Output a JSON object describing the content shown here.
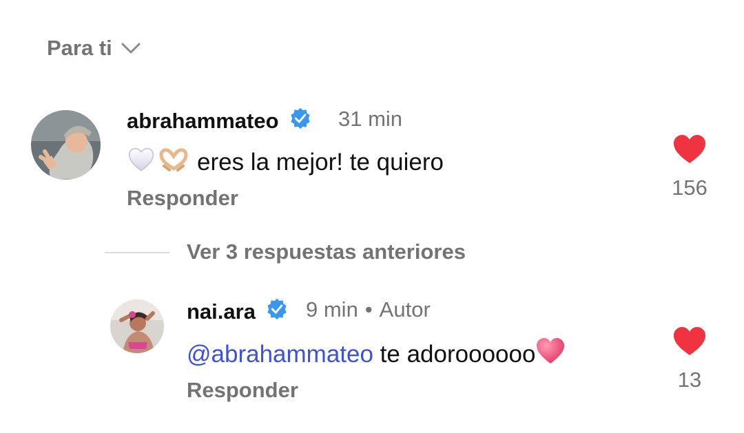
{
  "header": {
    "sort_label": "Para ti",
    "sort_icon": "chevron-down-icon"
  },
  "comments": [
    {
      "username": "abrahammateo",
      "verified": true,
      "time": "31 min",
      "text": "eres la mejor! te quiero",
      "emojis": [
        "white-heart-icon",
        "heart-hands-icon"
      ],
      "reply_label": "Responder",
      "likes": "156",
      "like_icon": "heart-icon",
      "like_color": "#ef3340"
    }
  ],
  "thread": {
    "view_more_label": "Ver 3 respuestas anteriores"
  },
  "replies": [
    {
      "username": "nai.ara",
      "verified": true,
      "time": "9 min",
      "separator": "•",
      "author_badge": "Autor",
      "mention": "@abrahammateo",
      "text": " te adoroooooo",
      "emojis": [
        "pink-heart-icon"
      ],
      "reply_label": "Responder",
      "likes": "13",
      "like_icon": "heart-icon",
      "like_color": "#ef3340"
    }
  ],
  "colors": {
    "mention": "#3d52d5",
    "verified": "#3897f0",
    "muted": "#737373"
  }
}
